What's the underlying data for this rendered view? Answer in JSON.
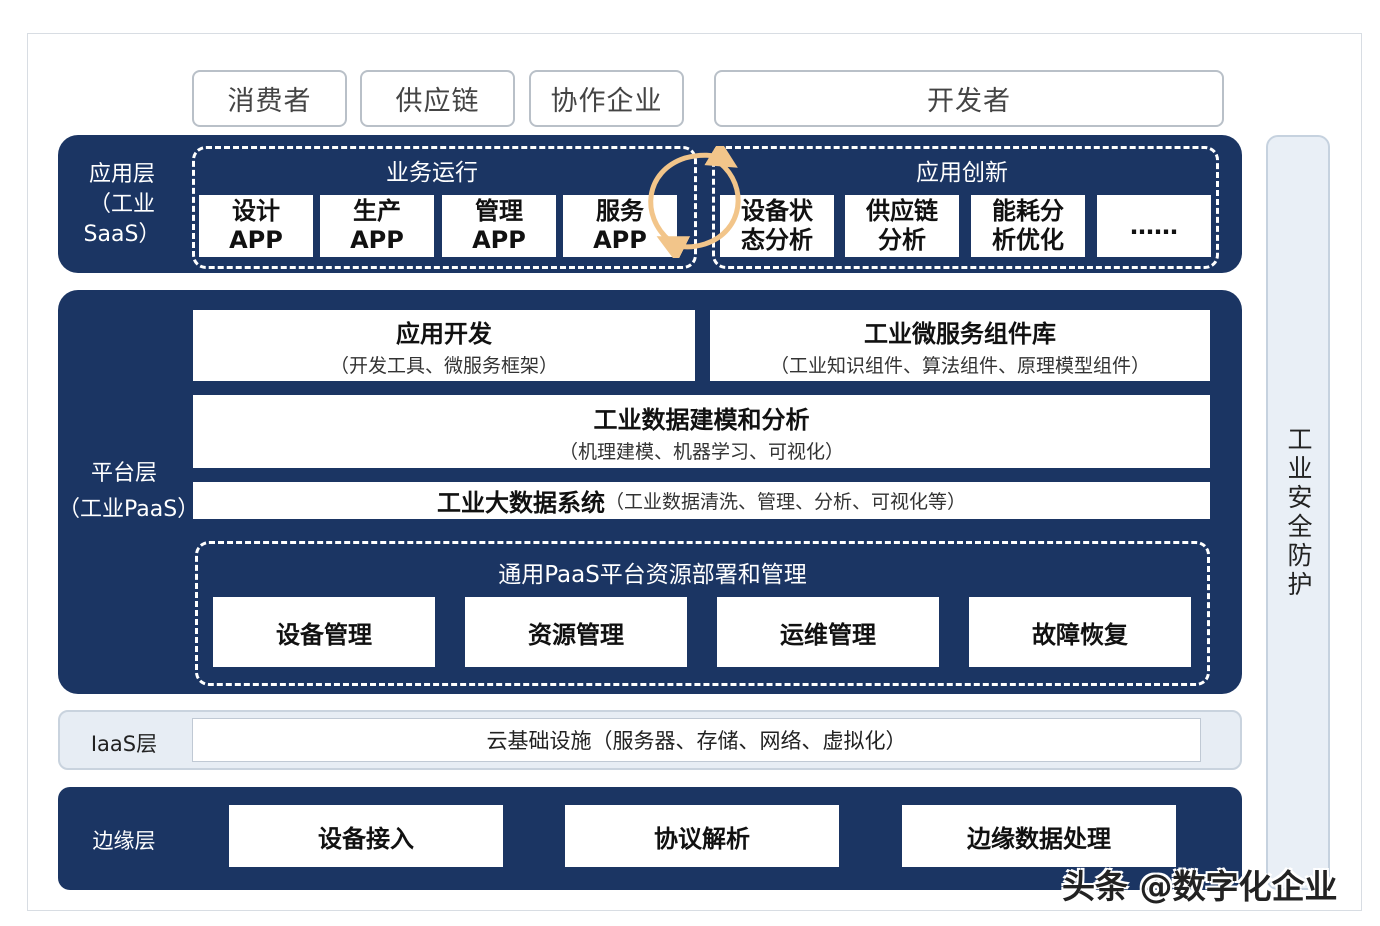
{
  "users": [
    "消费者",
    "供应链",
    "协作企业",
    "开发者"
  ],
  "saas": {
    "label_line1": "应用层",
    "label_line2": "（工业SaaS）",
    "business": {
      "title": "业务运行",
      "apps": [
        {
          "line1": "设计",
          "line2": "APP"
        },
        {
          "line1": "生产",
          "line2": "APP"
        },
        {
          "line1": "管理",
          "line2": "APP"
        },
        {
          "line1": "服务",
          "line2": "APP"
        }
      ]
    },
    "innovation": {
      "title": "应用创新",
      "apps": [
        {
          "line1": "设备状",
          "line2": "态分析"
        },
        {
          "line1": "供应链",
          "line2": "分析"
        },
        {
          "line1": "能耗分",
          "line2": "析优化"
        },
        {
          "line1": "……",
          "line2": ""
        }
      ]
    }
  },
  "paas": {
    "label_line1": "平台层",
    "label_line2": "（工业PaaS）",
    "app_dev": {
      "title": "应用开发",
      "sub": "（开发工具、微服务框架）"
    },
    "microservice": {
      "title": "工业微服务组件库",
      "sub": "（工业知识组件、算法组件、原理模型组件）"
    },
    "modeling": {
      "title": "工业数据建模和分析",
      "sub": "（机理建模、机器学习、可视化）"
    },
    "bigdata": {
      "title": "工业大数据系统",
      "sub": "（工业数据清洗、管理、分析、可视化等）"
    },
    "general": {
      "title": "通用PaaS平台资源部署和管理",
      "items": [
        "设备管理",
        "资源管理",
        "运维管理",
        "故障恢复"
      ]
    }
  },
  "iaas": {
    "label": "IaaS层",
    "content": "云基础设施（服务器、存储、网络、虚拟化）"
  },
  "edge": {
    "label": "边缘层",
    "items": [
      "设备接入",
      "协议解析",
      "边缘数据处理"
    ]
  },
  "security": "工业安全防护",
  "watermark": "头条 @数字化企业",
  "colors": {
    "navy": "#1b3563",
    "security_bg": "#e9eff6",
    "iaas_bg": "#e7edf4",
    "arrow": "#f2c58a"
  }
}
